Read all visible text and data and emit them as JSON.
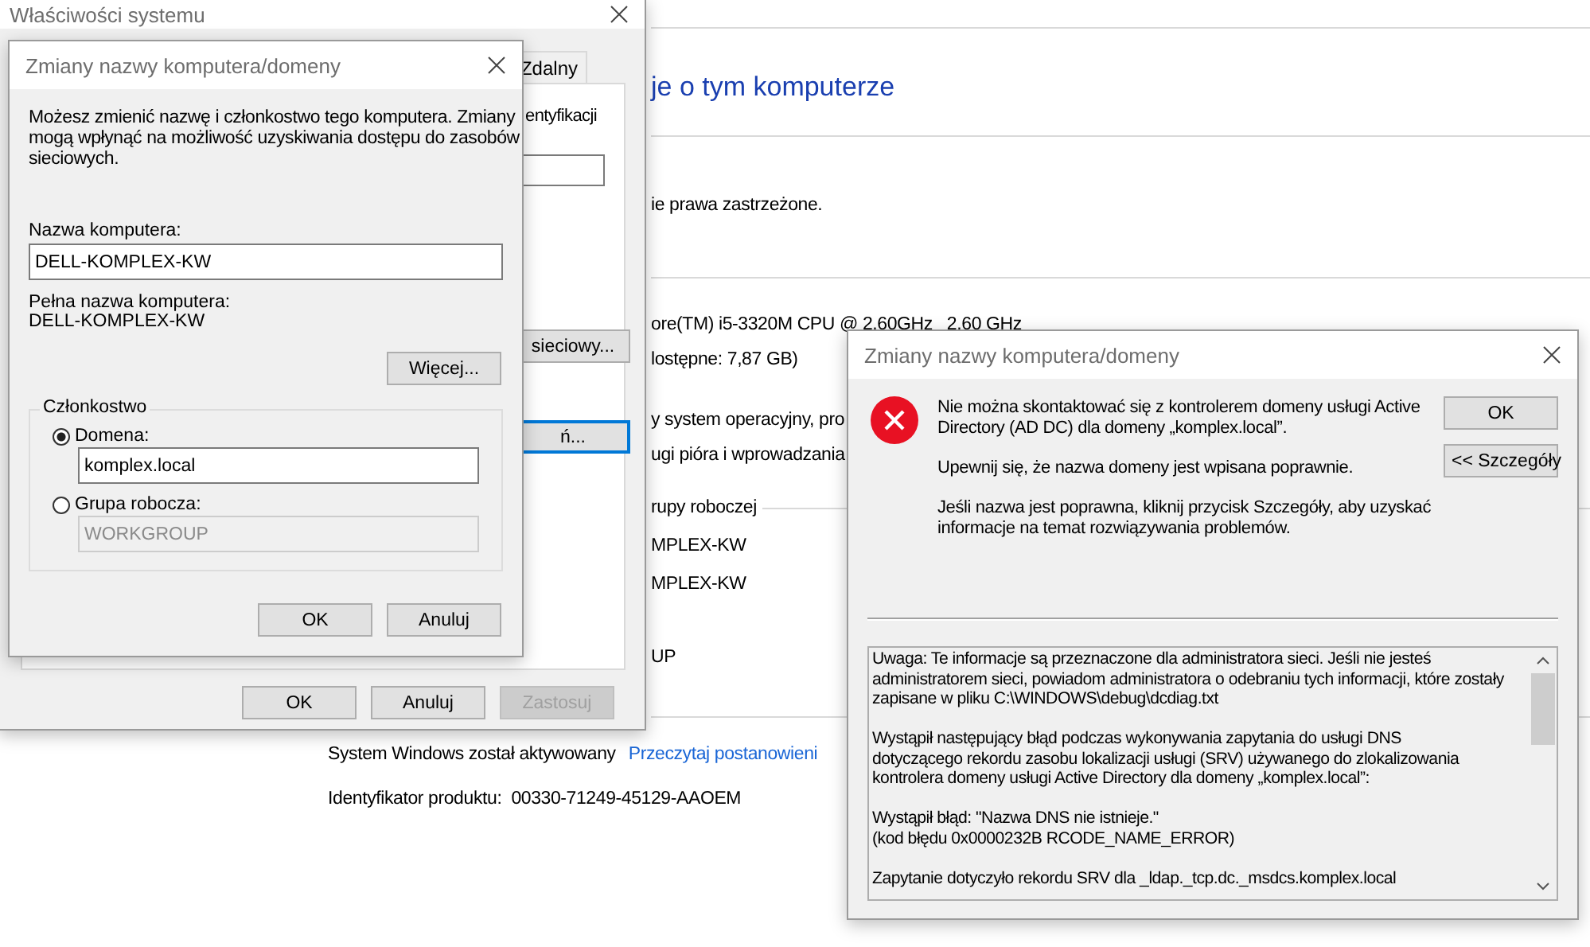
{
  "background_page": {
    "heading": "je o tym komputerze",
    "rows": [
      {
        "kind": "text",
        "text": "ie prawa zastrzeżone."
      },
      {
        "kind": "rule"
      },
      {
        "kind": "text",
        "text": "ore(TM) i5-3320M CPU @ 2.60GHz   2.60 GHz"
      },
      {
        "kind": "text",
        "text": "lostępne: 7,87 GB)"
      },
      {
        "kind": "text",
        "text": "y system operacyjny, pro"
      },
      {
        "kind": "text",
        "text": "ugi pióra i wprowadzania"
      },
      {
        "kind": "section",
        "text": "rupy roboczej"
      },
      {
        "kind": "text",
        "text": "MPLEX-KW"
      },
      {
        "kind": "text",
        "text": "MPLEX-KW"
      },
      {
        "kind": "text",
        "text": "UP"
      }
    ],
    "activation": {
      "status": "System Windows został aktywowany",
      "link": "Przeczytaj postanowieni"
    },
    "product_id": {
      "label": "Identyfikator produktu:",
      "value": "00330-71249-45129-AAOEM"
    }
  },
  "system_properties": {
    "title": "Właściwości systemu",
    "tabs": [
      {
        "label": "Zdalny",
        "selected": false
      }
    ],
    "fragment": "entyfikacji",
    "side_buttons": [
      {
        "label": "sieciowy...",
        "focused": false
      },
      {
        "label": "ń...",
        "focused": true
      }
    ],
    "buttons": [
      {
        "label": "OK",
        "disabled": false
      },
      {
        "label": "Anuluj",
        "disabled": false
      },
      {
        "label": "Zastosuj",
        "disabled": true
      }
    ]
  },
  "rename_dialog": {
    "title": "Zmiany nazwy komputera/domeny",
    "description": [
      "Możesz zmienić nazwę i członkostwo tego komputera. Zmiany",
      "mogą wpłynąć na możliwość uzyskiwania dostępu do zasobów",
      "sieciowych."
    ],
    "computer_name": {
      "label": "Nazwa komputera:",
      "value": "DELL-KOMPLEX-KW"
    },
    "full_name": {
      "label": "Pełna nazwa komputera:",
      "value": "DELL-KOMPLEX-KW"
    },
    "more_button": "Więcej...",
    "membership": {
      "title": "Członkostwo",
      "options": [
        {
          "label": "Domena:",
          "selected": true,
          "value": "komplex.local",
          "disabled": false
        },
        {
          "label": "Grupa robocza:",
          "selected": false,
          "value": "WORKGROUP",
          "disabled": true
        }
      ]
    },
    "buttons": [
      "OK",
      "Anuluj"
    ]
  },
  "error_dialog": {
    "title": "Zmiany nazwy komputera/domeny",
    "message": [
      [
        "Nie można skontaktować się z kontrolerem domeny usługi Active",
        "Directory (AD DC) dla domeny „komplex.local”."
      ],
      [
        "Upewnij się, że nazwa domeny jest wpisana poprawnie."
      ],
      [
        "Jeśli nazwa jest poprawna, kliknij przycisk Szczegóły, aby uzyskać",
        "informacje na temat rozwiązywania problemów."
      ]
    ],
    "buttons": [
      "OK",
      "<< Szczegóły"
    ],
    "details": [
      [
        "Uwaga: Te informacje są przeznaczone dla administratora sieci. Jeśli nie jesteś",
        "administratorem sieci, powiadom administratora o odebraniu tych informacji, które zostały",
        "zapisane w pliku C:\\WINDOWS\\debug\\dcdiag.txt"
      ],
      [
        "Wystąpił następujący błąd podczas wykonywania zapytania do usługi DNS",
        "dotyczącego rekordu zasobu lokalizacji usługi (SRV) używanego do zlokalizowania",
        "kontrolera domeny usługi Active Directory dla domeny „komplex.local”:"
      ],
      [
        "Wystąpił błąd: \"Nazwa DNS nie istnieje.\"",
        "(kod błędu 0x0000232B RCODE_NAME_ERROR)"
      ],
      [
        "Zapytanie dotyczyło rekordu SRV dla _ldap._tcp.dc._msdcs.komplex.local"
      ]
    ]
  }
}
